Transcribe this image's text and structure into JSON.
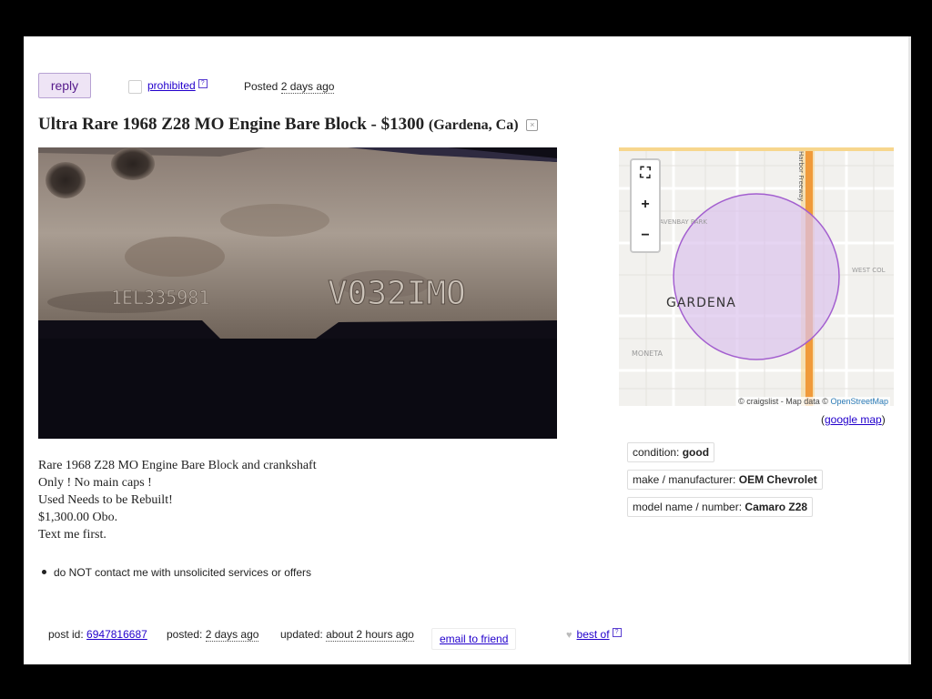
{
  "header": {
    "reply_label": "reply",
    "prohibited_label": "prohibited",
    "help_glyph": "?",
    "posted_prefix": "Posted",
    "posted_ago": "2 days ago"
  },
  "posting": {
    "title": "Ultra Rare 1968 Z28 MO Engine Bare Block - $1300",
    "location": "(Gardena, Ca)",
    "hide_glyph": "×"
  },
  "photo": {
    "stamp_left": "1EL335981",
    "stamp_right": "V032IMO"
  },
  "map": {
    "city_label": "GARDENA",
    "area_labels": [
      "RAVENBAY PARK",
      "WEST COL",
      "MONETA",
      "Harbor Freeway"
    ],
    "fullscreen_glyph": "⛶",
    "zoom_in": "+",
    "zoom_out": "−",
    "attribution": "© craigslist - Map data ©",
    "attribution_link": "OpenStreetMap",
    "google_open": "(",
    "google_link": "google map",
    "google_close": ")"
  },
  "attributes": [
    {
      "label": "condition:",
      "value": "good"
    },
    {
      "label": "make / manufacturer:",
      "value": "OEM Chevrolet"
    },
    {
      "label": "model name / number:",
      "value": "Camaro Z28"
    }
  ],
  "description": [
    "Rare 1968 Z28 MO Engine Bare Block and crankshaft",
    "Only ! No main caps !",
    "Used Needs to be Rebuilt!",
    "$1,300.00 Obo.",
    "Text me first."
  ],
  "notice": "do NOT contact me with unsolicited services or offers",
  "footer": {
    "post_id_label": "post id:",
    "post_id": "6947816687",
    "posted_label": "posted:",
    "posted_value": "2 days ago",
    "updated_label": "updated:",
    "updated_value": "about 2 hours ago",
    "email_label": "email to friend",
    "heart_glyph": "♥",
    "best_of_label": "best of",
    "help_glyph": "?"
  },
  "colors": {
    "link": "#2200cc",
    "reply_bg": "#eee4f5",
    "reply_text": "#551a8b",
    "map_circle": "#a35fcf",
    "freeway": "#f09a3a"
  }
}
